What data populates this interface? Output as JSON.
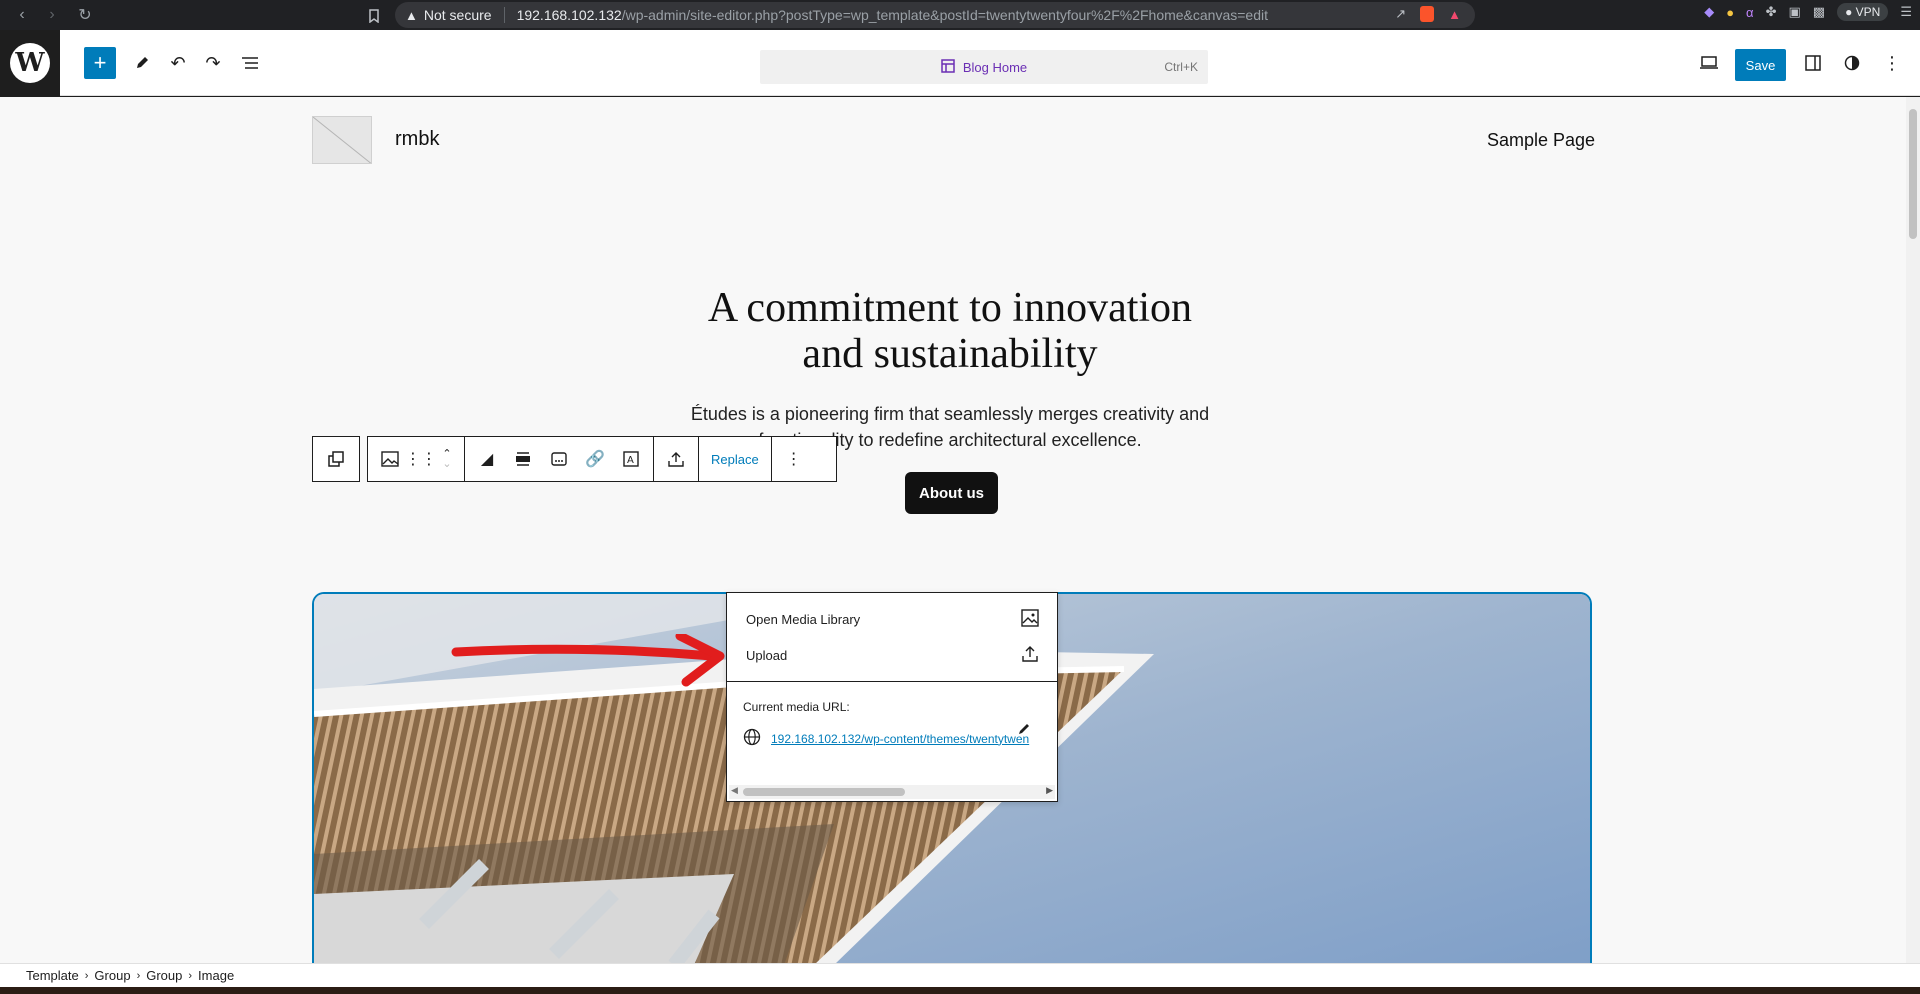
{
  "browser": {
    "security_label": "Not secure",
    "url_host": "192.168.102.132",
    "url_path": "/wp-admin/site-editor.php?postType=wp_template&postId=twentytwentyfour%2F%2Fhome&canvas=edit",
    "vpn_label": "VPN"
  },
  "editor": {
    "command_bar_label": "Blog Home",
    "command_bar_shortcut": "Ctrl+K",
    "save_label": "Save"
  },
  "site": {
    "title": "rmbk",
    "nav_item": "Sample Page",
    "hero_title_line1": "A commitment to innovation",
    "hero_title_line2": "and sustainability",
    "hero_desc_line1": "Études is a pioneering firm that seamlessly merges creativity and",
    "hero_desc_line2": "functionality to redefine architectural excellence.",
    "button_label": "About us"
  },
  "toolbar": {
    "replace_label": "Replace"
  },
  "replace_menu": {
    "items": [
      {
        "label": "Open Media Library",
        "icon": "image-icon"
      },
      {
        "label": "Upload",
        "icon": "upload-icon"
      }
    ],
    "current_url_label": "Current media URL:",
    "current_url": "192.168.102.132/wp-content/themes/twentytwen"
  },
  "breadcrumb": [
    "Template",
    "Group",
    "Group",
    "Image"
  ],
  "colors": {
    "accent": "#007cba",
    "annotation": "#e11d1d"
  }
}
